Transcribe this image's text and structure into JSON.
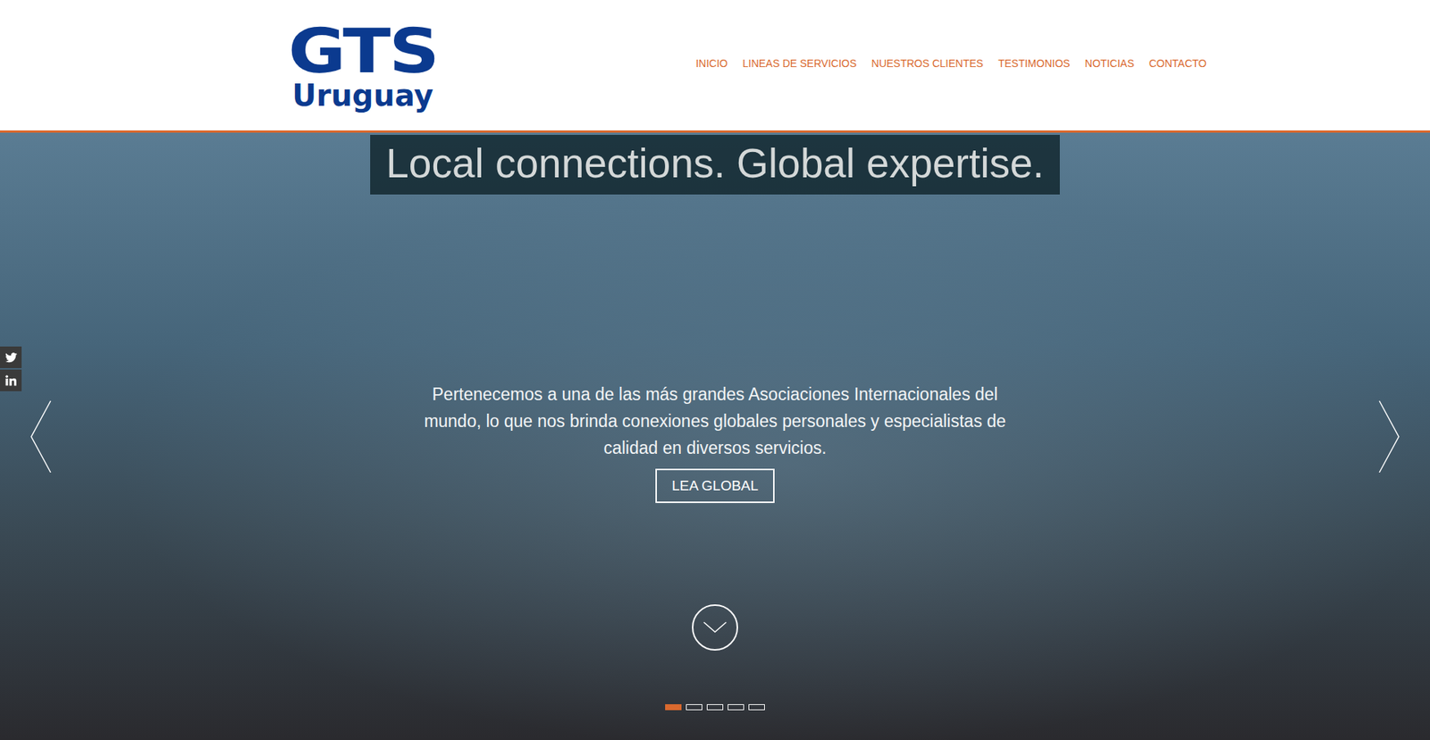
{
  "logo": {
    "main": "GTS",
    "sub": "Uruguay"
  },
  "nav": [
    "INICIO",
    "LINEAS DE SERVICIOS",
    "NUESTROS CLIENTES",
    "TESTIMONIOS",
    "NOTICIAS",
    "CONTACTO"
  ],
  "slider": {
    "title": "Local connections. Global expertise.",
    "text": "Pertenecemos a una de las más grandes Asociaciones Internacionales del mundo, lo que nos brinda conexiones globales personales y especialistas de calidad en diversos servicios.",
    "button": "LEA GLOBAL",
    "indicators": [
      {
        "selected": true
      },
      {
        "selected": false
      },
      {
        "selected": false
      },
      {
        "selected": false
      },
      {
        "selected": false
      }
    ]
  }
}
